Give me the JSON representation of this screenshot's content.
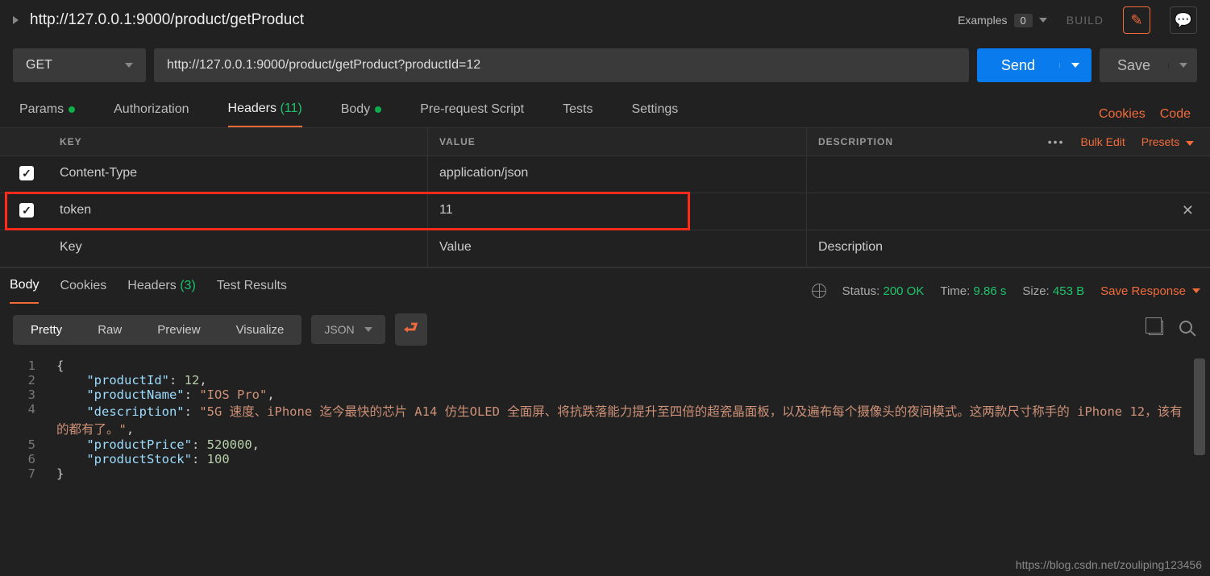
{
  "topbar": {
    "title": "http://127.0.0.1:9000/product/getProduct",
    "examples_label": "Examples",
    "examples_count": "0",
    "build_label": "BUILD"
  },
  "request": {
    "method": "GET",
    "url": "http://127.0.0.1:9000/product/getProduct?productId=12",
    "send_label": "Send",
    "save_label": "Save"
  },
  "reqtabs": {
    "params": "Params",
    "authorization": "Authorization",
    "headers": "Headers",
    "headers_count": "(11)",
    "body": "Body",
    "prerequest": "Pre-request Script",
    "tests": "Tests",
    "settings": "Settings",
    "cookies": "Cookies",
    "code": "Code"
  },
  "headerTable": {
    "columns": {
      "key": "KEY",
      "value": "VALUE",
      "desc": "DESCRIPTION"
    },
    "bulk_edit": "Bulk Edit",
    "presets": "Presets",
    "rows": [
      {
        "checked": true,
        "key": "Content-Type",
        "value": "application/json"
      },
      {
        "checked": true,
        "key": "token",
        "value": "11",
        "highlight": true
      }
    ],
    "placeholders": {
      "key": "Key",
      "value": "Value",
      "desc": "Description"
    }
  },
  "respTabs": {
    "body": "Body",
    "cookies": "Cookies",
    "headers": "Headers",
    "headers_count": "(3)",
    "test_results": "Test Results"
  },
  "respMeta": {
    "status_label": "Status:",
    "status_value": "200 OK",
    "time_label": "Time:",
    "time_value": "9.86 s",
    "size_label": "Size:",
    "size_value": "453 B",
    "save_response": "Save Response"
  },
  "format": {
    "pretty": "Pretty",
    "raw": "Raw",
    "preview": "Preview",
    "visualize": "Visualize",
    "json": "JSON"
  },
  "jsonBody": {
    "productId": 12,
    "productName": "IOS Pro",
    "description": "5G 速度、iPhone 迄今最快的芯片 A14 仿生OLED 全面屏、将抗跌落能力提升至四倍的超瓷晶面板，以及遍布每个摄像头的夜间模式。这两款尺寸称手的 iPhone 12，该有的都有了。",
    "productPrice": 520000,
    "productStock": 100
  },
  "watermark": "https://blog.csdn.net/zouliping123456"
}
